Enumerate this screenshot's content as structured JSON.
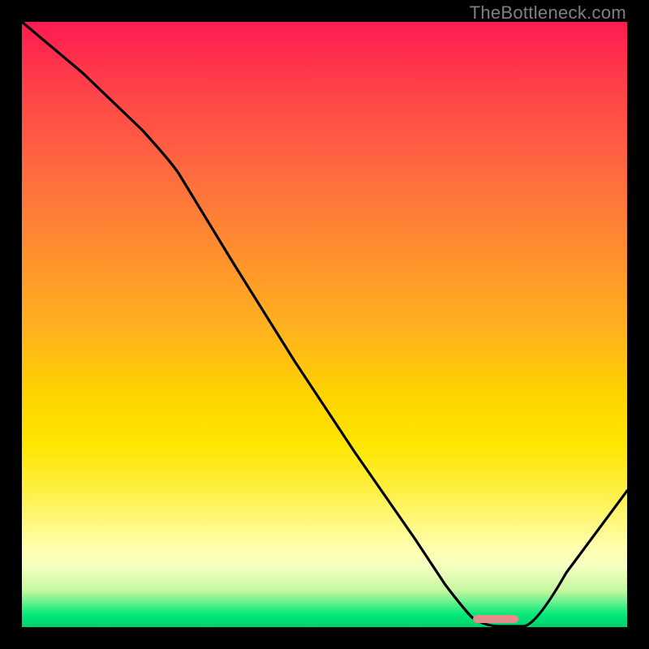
{
  "watermark": "TheBottleneck.com",
  "chart_data": {
    "type": "line",
    "title": "",
    "xlabel": "",
    "ylabel": "",
    "xlim": [
      0,
      1
    ],
    "ylim": [
      0,
      1
    ],
    "series": [
      {
        "name": "bottleneck-curve",
        "x": [
          0.0,
          0.1,
          0.2,
          0.26,
          0.35,
          0.45,
          0.55,
          0.65,
          0.7,
          0.74,
          0.79,
          0.83,
          0.9,
          1.0
        ],
        "y": [
          1.0,
          0.915,
          0.82,
          0.76,
          0.6,
          0.44,
          0.29,
          0.145,
          0.07,
          0.02,
          0.0,
          0.001,
          0.09,
          0.225
        ]
      }
    ],
    "marker": {
      "x_start": 0.745,
      "x_end": 0.82,
      "y": 0.007
    },
    "gradient_stops": [
      {
        "pos": 0.0,
        "color": "#ff1a52"
      },
      {
        "pos": 0.25,
        "color": "#ff6b3f"
      },
      {
        "pos": 0.5,
        "color": "#ffb020"
      },
      {
        "pos": 0.7,
        "color": "#ffe600"
      },
      {
        "pos": 0.9,
        "color": "#f5ffc0"
      },
      {
        "pos": 1.0,
        "color": "#00d36a"
      }
    ]
  }
}
